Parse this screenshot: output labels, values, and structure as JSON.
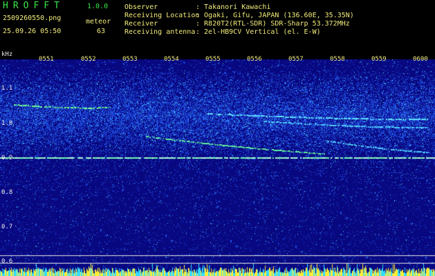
{
  "header": {
    "app_name": "HROFFT",
    "version": "1.0.0",
    "filename": "2509260550.png",
    "meteor_label": "meteor",
    "datetime": "25.09.26 05:50",
    "meteor_count": "63"
  },
  "station": {
    "observer_label": "Observer",
    "observer_value": ": Takanori Kawachi",
    "location_label": "Receiving Location",
    "location_value": ": Ogaki, Gifu, JAPAN (136.60E, 35.35N)",
    "receiver_label": "Receiver",
    "receiver_value": ": R820T2(RTL-SDR) SDR-Sharp 53.372MHz",
    "antenna_label": "Receiving antenna",
    "antenna_value": ": 2el-HB9CV Vertical (el. E-W)"
  },
  "spectrogram": {
    "y_unit": "kHz",
    "y_ticks": [
      "1.1",
      "1.0",
      "0.9",
      "0.8",
      "0.7",
      "0.6"
    ],
    "x_ticks": [
      "0551",
      "0552",
      "0553",
      "0554",
      "0555",
      "0556",
      "0557",
      "0558",
      "0559",
      "0600"
    ],
    "y_range_khz": [
      0.58,
      1.12
    ],
    "time_range_min": [
      0,
      10
    ],
    "colors": {
      "background": "#0c0c8a",
      "noise": "#2a5cff",
      "signal": "#60ff80",
      "carrier": "#aaffcc",
      "baseline": "#ffff40"
    }
  }
}
